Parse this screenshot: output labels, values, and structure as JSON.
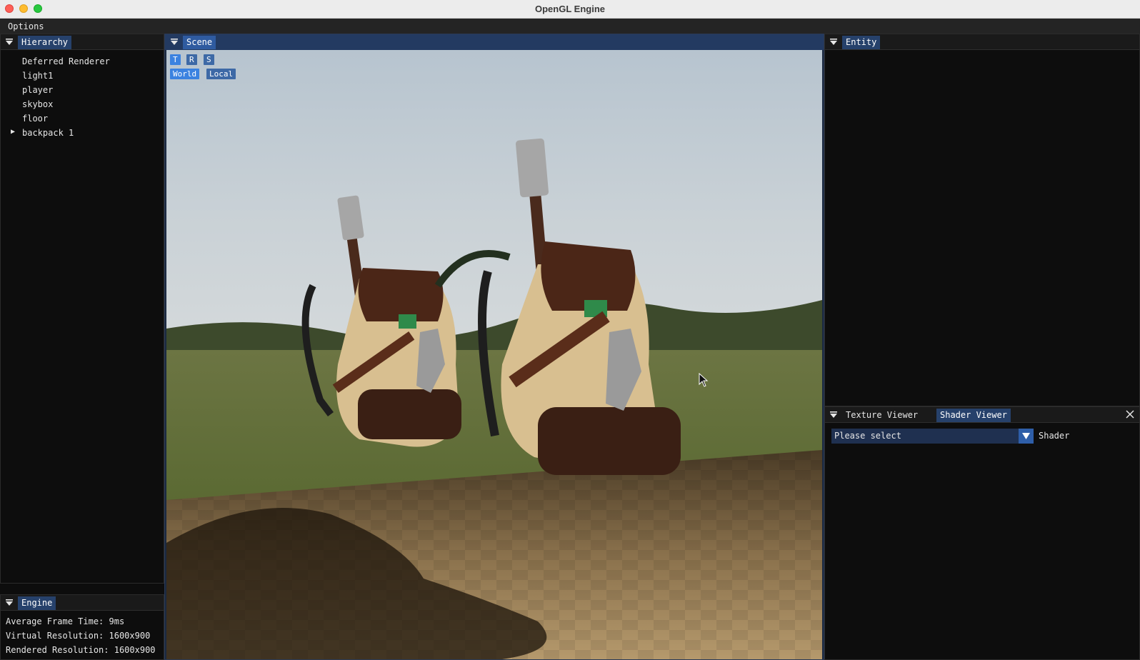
{
  "window": {
    "title": "OpenGL Engine"
  },
  "menubar": {
    "items": [
      {
        "label": "Options"
      }
    ]
  },
  "hierarchy": {
    "tab_label": "Hierarchy",
    "items": [
      {
        "label": "Deferred Renderer"
      },
      {
        "label": "light1"
      },
      {
        "label": "player"
      },
      {
        "label": "skybox"
      },
      {
        "label": "floor"
      },
      {
        "label": "backpack 1",
        "expandable": true
      }
    ]
  },
  "engine": {
    "tab_label": "Engine",
    "stats": [
      "Average Frame Time: 9ms",
      "Virtual Resolution: 1600x900",
      "Rendered Resolution: 1600x900"
    ]
  },
  "scene": {
    "tab_label": "Scene",
    "gizmo_modes": [
      {
        "label": "T",
        "active": true
      },
      {
        "label": "R",
        "active": false
      },
      {
        "label": "S",
        "active": false
      }
    ],
    "spaces": [
      {
        "label": "World",
        "active": true
      },
      {
        "label": "Local",
        "active": false
      }
    ]
  },
  "entity": {
    "tab_label": "Entity"
  },
  "viewer": {
    "tabs": [
      {
        "label": "Texture Viewer",
        "active": false
      },
      {
        "label": "Shader Viewer",
        "active": true
      }
    ],
    "shader_select": {
      "value": "Please select",
      "label": "Shader"
    }
  },
  "colors": {
    "accent": "#26416b",
    "active_button": "#3b82e0",
    "panel_bg": "#0d0d0d"
  }
}
